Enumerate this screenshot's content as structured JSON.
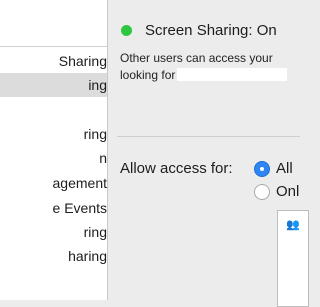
{
  "sidebar": {
    "items": [
      {
        "label": "Sharing"
      },
      {
        "label": "ing"
      },
      {
        "label": "ring"
      },
      {
        "label": "n"
      },
      {
        "label": "agement"
      },
      {
        "label": "e Events"
      },
      {
        "label": "ring"
      },
      {
        "label": "haring"
      }
    ]
  },
  "status": {
    "title": "Screen Sharing: On",
    "color": "#2ec73f"
  },
  "description": {
    "line1": "Other users can access your",
    "line2": "looking for"
  },
  "access": {
    "label": "Allow access for:",
    "options": [
      {
        "label": "All",
        "selected": true
      },
      {
        "label": "Onl",
        "selected": false
      }
    ]
  },
  "users_list": {
    "icon": "users-icon"
  }
}
